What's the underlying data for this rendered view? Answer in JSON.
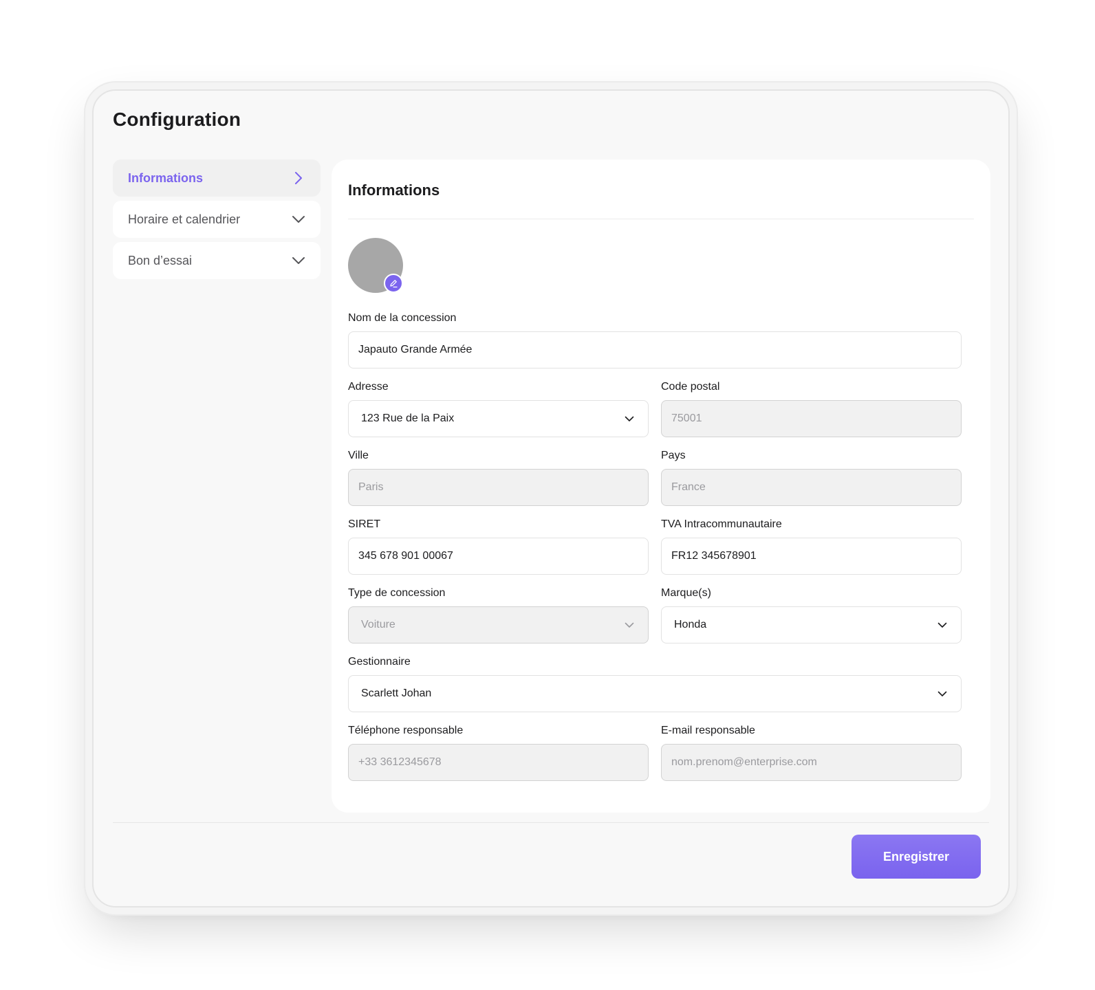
{
  "page": {
    "title": "Configuration"
  },
  "sidebar": {
    "items": [
      {
        "label": "Informations",
        "icon": "chevron-right-icon",
        "active": true
      },
      {
        "label": "Horaire et calendrier",
        "icon": "chevron-down-icon",
        "active": false
      },
      {
        "label": "Bon d’essai",
        "icon": "chevron-down-icon",
        "active": false
      }
    ]
  },
  "panel": {
    "title": "Informations",
    "avatar_edit_icon": "pencil-icon"
  },
  "form": {
    "nom": {
      "label": "Nom de la concession",
      "value": "Japauto Grande Armée"
    },
    "adresse": {
      "label": "Adresse",
      "value": "123 Rue de la Paix"
    },
    "code_postal": {
      "label": "Code postal",
      "placeholder": "75001"
    },
    "ville": {
      "label": "Ville",
      "placeholder": "Paris"
    },
    "pays": {
      "label": "Pays",
      "placeholder": "France"
    },
    "siret": {
      "label": "SIRET",
      "value": "345 678 901 00067"
    },
    "tva": {
      "label": "TVA Intracommunautaire",
      "value": "FR12 345678901"
    },
    "type": {
      "label": "Type de concession",
      "placeholder": "Voiture"
    },
    "marques": {
      "label": "Marque(s)",
      "value": "Honda"
    },
    "gestionnaire": {
      "label": "Gestionnaire",
      "value": "Scarlett Johan"
    },
    "telephone": {
      "label": "Téléphone responsable",
      "placeholder": "+33 3612345678"
    },
    "email": {
      "label": "E-mail responsable",
      "placeholder": "nom.prenom@enterprise.com"
    }
  },
  "footer": {
    "save_label": "Enregistrer"
  },
  "colors": {
    "accent": "#7b64ee",
    "disabled_bg": "#f1f1f1",
    "text": "#1c1c1e"
  }
}
